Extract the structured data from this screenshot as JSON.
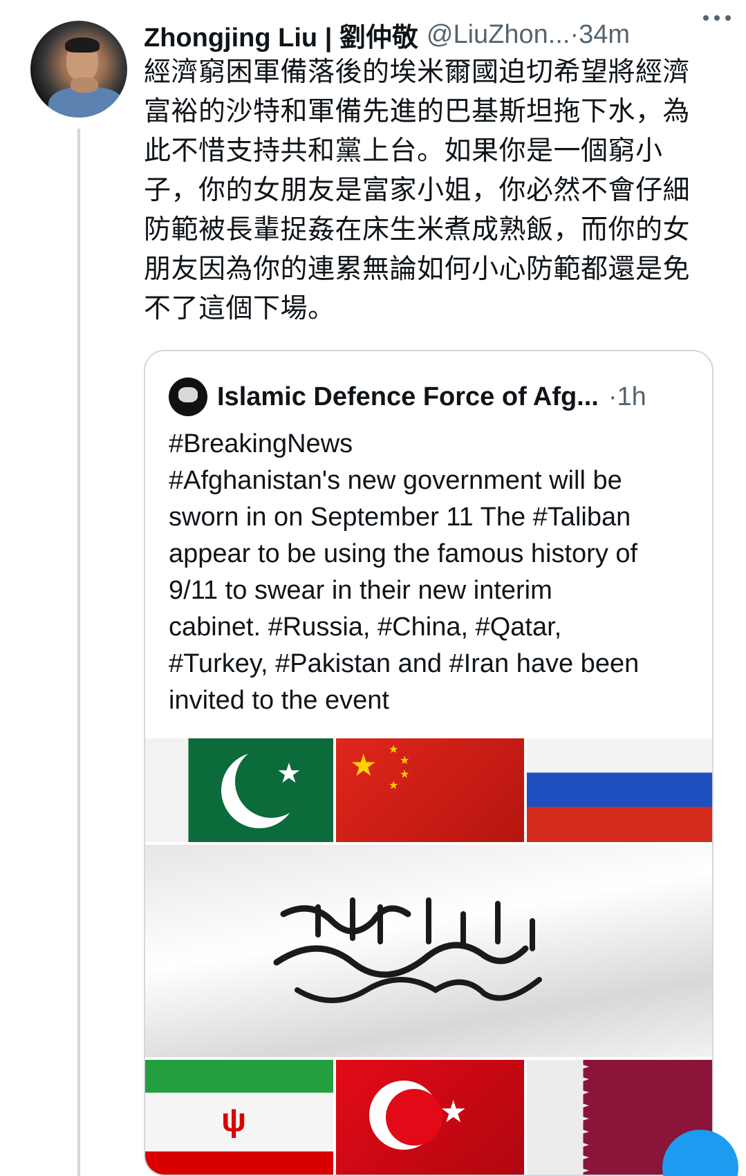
{
  "tweet": {
    "author_name": "Zhongjing Liu | 劉仲敬",
    "handle": "@LiuZhon...",
    "separator": " · ",
    "time": "34m",
    "text": "經濟窮困軍備落後的埃米爾國迫切希望將經濟富裕的沙特和軍備先進的巴基斯坦拖下水，為此不惜支持共和黨上台。如果你是一個窮小子，你的女朋友是富家小姐，你必然不會仔細防範被長輩捉姦在床生米煮成熟飯，而你的女朋友因為你的連累無論如何小心防範都還是免不了這個下場。"
  },
  "quoted_tweet": {
    "author_name": "Islamic Defence Force of Afg...",
    "separator": " · ",
    "time": "1h",
    "lines": [
      "#BreakingNews",
      "#Afghanistan's new government will be",
      "sworn in on September 11 The #Taliban",
      "appear to be using the famous history of",
      "9/11 to swear in their new interim",
      "cabinet. #Russia, #China, #Qatar,",
      "#Turkey, #Pakistan and #Iran have been",
      "invited to the event"
    ]
  },
  "media": {
    "flags": [
      "pakistan-flag",
      "china-flag",
      "russia-flag",
      "taliban-flag",
      "iran-flag",
      "turkey-flag",
      "qatar-flag"
    ]
  },
  "icons": {
    "more": "more-icon",
    "compose": "compose-fab"
  },
  "colors": {
    "text": "#0f1419",
    "secondary": "#536471",
    "border": "#cfd9de",
    "accent": "#1d9bf0"
  }
}
